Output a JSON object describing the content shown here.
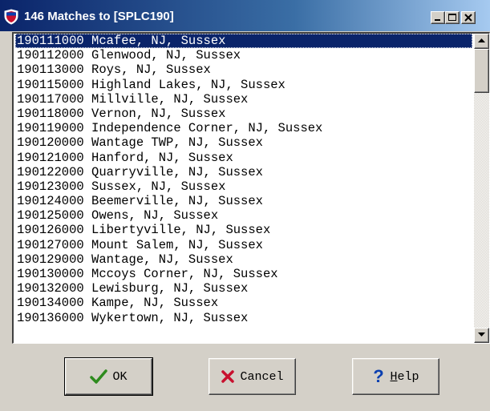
{
  "window": {
    "title": "146 Matches to [SPLC190]"
  },
  "list": {
    "items": [
      "190111000 Mcafee, NJ, Sussex",
      "190112000 Glenwood, NJ, Sussex",
      "190113000 Roys, NJ, Sussex",
      "190115000 Highland Lakes, NJ, Sussex",
      "190117000 Millville, NJ, Sussex",
      "190118000 Vernon, NJ, Sussex",
      "190119000 Independence Corner, NJ, Sussex",
      "190120000 Wantage TWP, NJ, Sussex",
      "190121000 Hanford, NJ, Sussex",
      "190122000 Quarryville, NJ, Sussex",
      "190123000 Sussex, NJ, Sussex",
      "190124000 Beemerville, NJ, Sussex",
      "190125000 Owens, NJ, Sussex",
      "190126000 Libertyville, NJ, Sussex",
      "190127000 Mount Salem, NJ, Sussex",
      "190129000 Wantage, NJ, Sussex",
      "190130000 Mccoys Corner, NJ, Sussex",
      "190132000 Lewisburg, NJ, Sussex",
      "190134000 Kampe, NJ, Sussex",
      "190136000 Wykertown, NJ, Sussex"
    ],
    "selected_index": 0
  },
  "buttons": {
    "ok_label": "OK",
    "cancel_label": "Cancel",
    "help_label_rest": "elp",
    "help_label_accel": "H"
  },
  "icons": {
    "title": "shield-icon",
    "ok": "checkmark-icon",
    "cancel": "x-mark-icon",
    "help": "question-mark-icon"
  },
  "colors": {
    "titlebar": "#0a246a",
    "selection": "#0a246a",
    "ok_check": "#2e8b1e",
    "cancel_x": "#c8102e",
    "help_q": "#0a3fb0"
  }
}
